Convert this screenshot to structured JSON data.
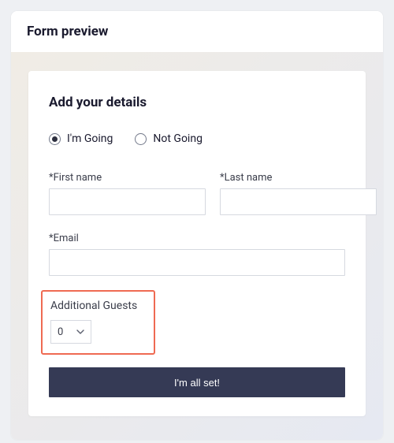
{
  "header": {
    "title": "Form preview"
  },
  "form": {
    "title": "Add your details",
    "rsvp": {
      "going_label": "I'm Going",
      "not_going_label": "Not Going",
      "selected": "going"
    },
    "fields": {
      "first_name_label": "*First name",
      "last_name_label": "*Last name",
      "email_label": "*Email",
      "first_name_value": "",
      "last_name_value": "",
      "email_value": ""
    },
    "guests": {
      "label": "Additional Guests",
      "value": "0"
    },
    "submit_label": "I'm all set!"
  },
  "colors": {
    "highlight_border": "#ef6a52",
    "submit_bg": "#353a55"
  }
}
